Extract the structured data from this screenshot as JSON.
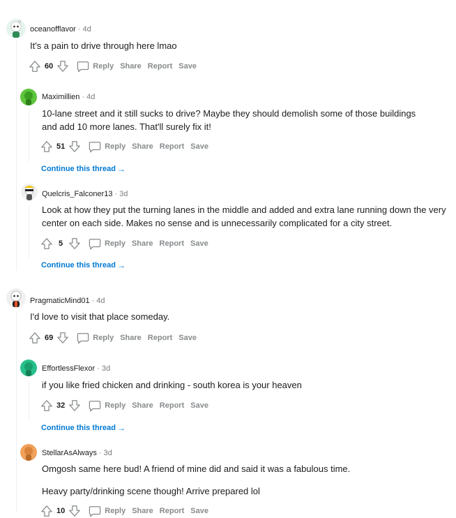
{
  "actions": {
    "reply": "Reply",
    "share": "Share",
    "report": "Report",
    "save": "Save"
  },
  "continue_label": "Continue this thread",
  "continue_arrow": "→",
  "dot": "·",
  "comments": [
    {
      "user": "oceanofflavor",
      "age": "4d",
      "text": "It's a pain to drive through here lmao",
      "score": "60"
    },
    {
      "user": "Maximillien",
      "age": "4d",
      "text": "10-lane street and it still sucks to drive? Maybe they should demolish some of those buildings and add 10 more lanes. That'll surely fix it!",
      "score": "51"
    },
    {
      "user": "Quelcris_Falconer13",
      "age": "3d",
      "text": "Look at how they put the turning lanes in the middle and added and extra lane running down the very center on each side. Makes no sense and is unnecessarily complicated for a city street.",
      "score": "5"
    },
    {
      "user": "PragmaticMind01",
      "age": "4d",
      "text": "I'd love to visit that place someday.",
      "score": "69"
    },
    {
      "user": "EffortlessFlexor",
      "age": "3d",
      "text": "if you like fried chicken and drinking - south korea is your heaven",
      "score": "32"
    },
    {
      "user": "StellarAsAlways",
      "age": "3d",
      "text": "Omgosh same here bud! A friend of mine did and said it was a fabulous time.",
      "text2": "Heavy party/drinking scene though! Arrive prepared lol",
      "score": "10"
    }
  ],
  "avatar_colors": {
    "oceanofflavor": "#e6f4ee",
    "Maximillien": "#5ec43c",
    "Quelcris_Falconer13": "#f0f0f0",
    "PragmaticMind01": "#f0f0f0",
    "EffortlessFlexor": "#27c08a",
    "StellarAsAlways": "#f0a15b"
  }
}
